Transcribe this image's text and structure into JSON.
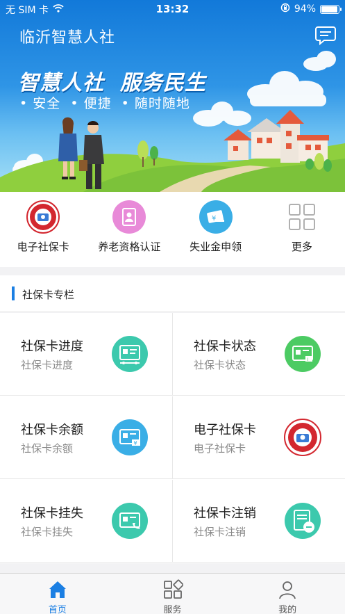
{
  "status_bar": {
    "carrier": "无 SIM 卡",
    "time": "13:32",
    "battery": "94%",
    "battery_level": 0.94
  },
  "header": {
    "title": "临沂智慧人社",
    "chat_icon": "chat-bubble-icon"
  },
  "banner": {
    "slogan": "智慧人社  服务民生",
    "tagline": "• 安全  • 便捷  • 随时随地"
  },
  "quick_menu": [
    {
      "label": "电子社保卡",
      "icon": "social-security-card-badge-icon"
    },
    {
      "label": "养老资格认证",
      "icon": "id-card-portrait-icon"
    },
    {
      "label": "失业金申领",
      "icon": "yuan-card-icon"
    },
    {
      "label": "更多",
      "icon": "grid-more-icon"
    }
  ],
  "section": {
    "title": "社保卡专栏"
  },
  "cards": [
    {
      "title": "社保卡进度",
      "subtitle": "社保卡进度",
      "icon": "card-progress-icon"
    },
    {
      "title": "社保卡状态",
      "subtitle": "社保卡状态",
      "icon": "card-status-icon"
    },
    {
      "title": "社保卡余额",
      "subtitle": "社保卡余额",
      "icon": "card-balance-icon"
    },
    {
      "title": "电子社保卡",
      "subtitle": "电子社保卡",
      "icon": "social-security-card-badge-icon"
    },
    {
      "title": "社保卡挂失",
      "subtitle": "社保卡挂失",
      "icon": "card-report-loss-icon"
    },
    {
      "title": "社保卡注销",
      "subtitle": "社保卡注销",
      "icon": "card-cancel-icon"
    }
  ],
  "colors": {
    "primary": "#1b7fe3",
    "teal": "#3cc9ad",
    "green": "#4ccb63",
    "blue": "#3aaee6",
    "pink": "#e88ad8"
  },
  "tabs": [
    {
      "label": "首页",
      "icon": "home-icon",
      "active": true
    },
    {
      "label": "服务",
      "icon": "services-grid-icon",
      "active": false
    },
    {
      "label": "我的",
      "icon": "user-profile-icon",
      "active": false
    }
  ]
}
